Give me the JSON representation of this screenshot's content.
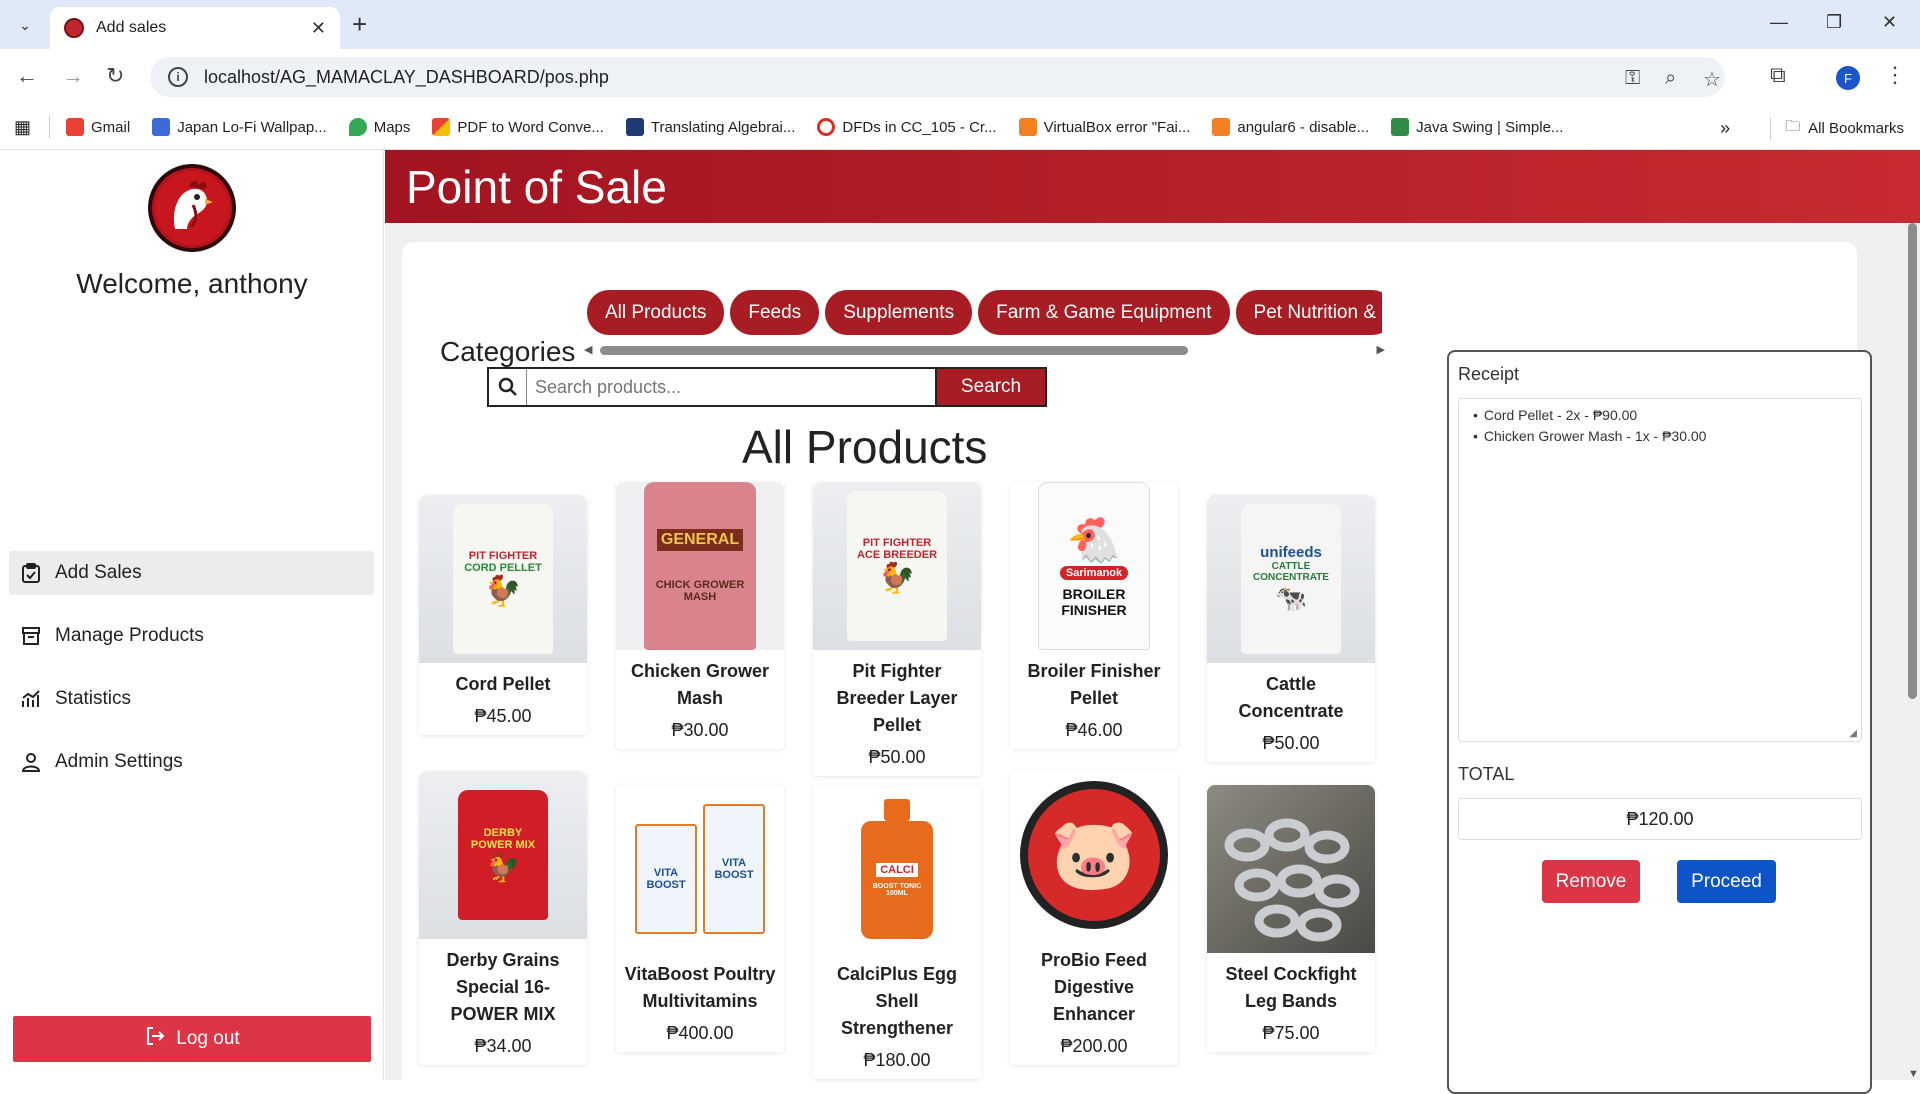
{
  "browser": {
    "tab_title": "Add sales",
    "url": "localhost/AG_MAMACLAY_DASHBOARD/pos.php",
    "profile_initial": "F",
    "bookmarks": [
      {
        "label": "Gmail",
        "color": "#ea4335"
      },
      {
        "label": "Japan Lo-Fi Wallpap...",
        "color": "#3c6bd8"
      },
      {
        "label": "Maps",
        "color": "#34a853"
      },
      {
        "label": "PDF to Word Conve...",
        "color": "#e94235"
      },
      {
        "label": "Translating Algebrai...",
        "color": "#1f3b73"
      },
      {
        "label": "DFDs in CC_105 - Cr...",
        "color": "#d93025"
      },
      {
        "label": "VirtualBox error \"Fai...",
        "color": "#f48024"
      },
      {
        "label": "angular6 - disable...",
        "color": "#f48024"
      },
      {
        "label": "Java Swing | Simple...",
        "color": "#2f8d46"
      }
    ],
    "all_bookmarks": "All Bookmarks"
  },
  "sidebar": {
    "welcome": "Welcome, anthony",
    "items": [
      {
        "label": "Add Sales",
        "icon": "clipboard-check-icon"
      },
      {
        "label": "Manage Products",
        "icon": "archive-box-icon"
      },
      {
        "label": "Statistics",
        "icon": "chart-line-icon"
      },
      {
        "label": "Admin Settings",
        "icon": "person-icon"
      }
    ],
    "logout": "Log out"
  },
  "header": {
    "title": "Point of Sale"
  },
  "categories": {
    "label": "Categories",
    "items": [
      "All Products",
      "Feeds",
      "Supplements",
      "Farm & Game Equipment",
      "Pet Nutrition &"
    ]
  },
  "search": {
    "placeholder": "Search products...",
    "button": "Search"
  },
  "products_title": "All Products",
  "products": [
    {
      "name": "Cord Pellet",
      "price": "₱45.00"
    },
    {
      "name": "Chicken Grower Mash",
      "price": "₱30.00"
    },
    {
      "name": "Pit Fighter Breeder Layer Pellet",
      "price": "₱50.00"
    },
    {
      "name": "Broiler Finisher Pellet",
      "price": "₱46.00"
    },
    {
      "name": "Cattle Concentrate",
      "price": "₱50.00"
    },
    {
      "name": "Derby Grains Special 16-POWER MIX",
      "price": "₱34.00"
    },
    {
      "name": "VitaBoost Poultry Multivitamins",
      "price": "₱400.00"
    },
    {
      "name": "CalciPlus Egg Shell Strengthener",
      "price": "₱180.00"
    },
    {
      "name": "ProBio Feed Digestive Enhancer",
      "price": "₱200.00"
    },
    {
      "name": "Steel Cockfight Leg Bands",
      "price": "₱75.00"
    }
  ],
  "product_image_text": {
    "cord_brand": "PIT FIGHTER",
    "cord_label": "CORD PELLET",
    "grower_brand": "GENERAL",
    "grower_label": "CHICK GROWER MASH",
    "breeder_brand": "PIT FIGHTER",
    "breeder_label": "ACE BREEDER",
    "broiler_brand": "Sarimanok",
    "broiler_label": "BROILER FINISHER",
    "cattle_brand": "unifeeds",
    "cattle_label": "CATTLE CONCENTRATE",
    "derby_brand": "DERBY",
    "derby_label": "POWER MIX",
    "vita_label": "VITA BOOST",
    "calci_label": "CALCI",
    "calci_side": "BOOST TONIC 100ML"
  },
  "receipt": {
    "label": "Receipt",
    "lines": [
      "Cord Pellet - 2x - ₱90.00",
      "Chicken Grower Mash - 1x - ₱30.00"
    ],
    "total_label": "TOTAL",
    "total": "₱120.00",
    "remove": "Remove",
    "proceed": "Proceed"
  }
}
